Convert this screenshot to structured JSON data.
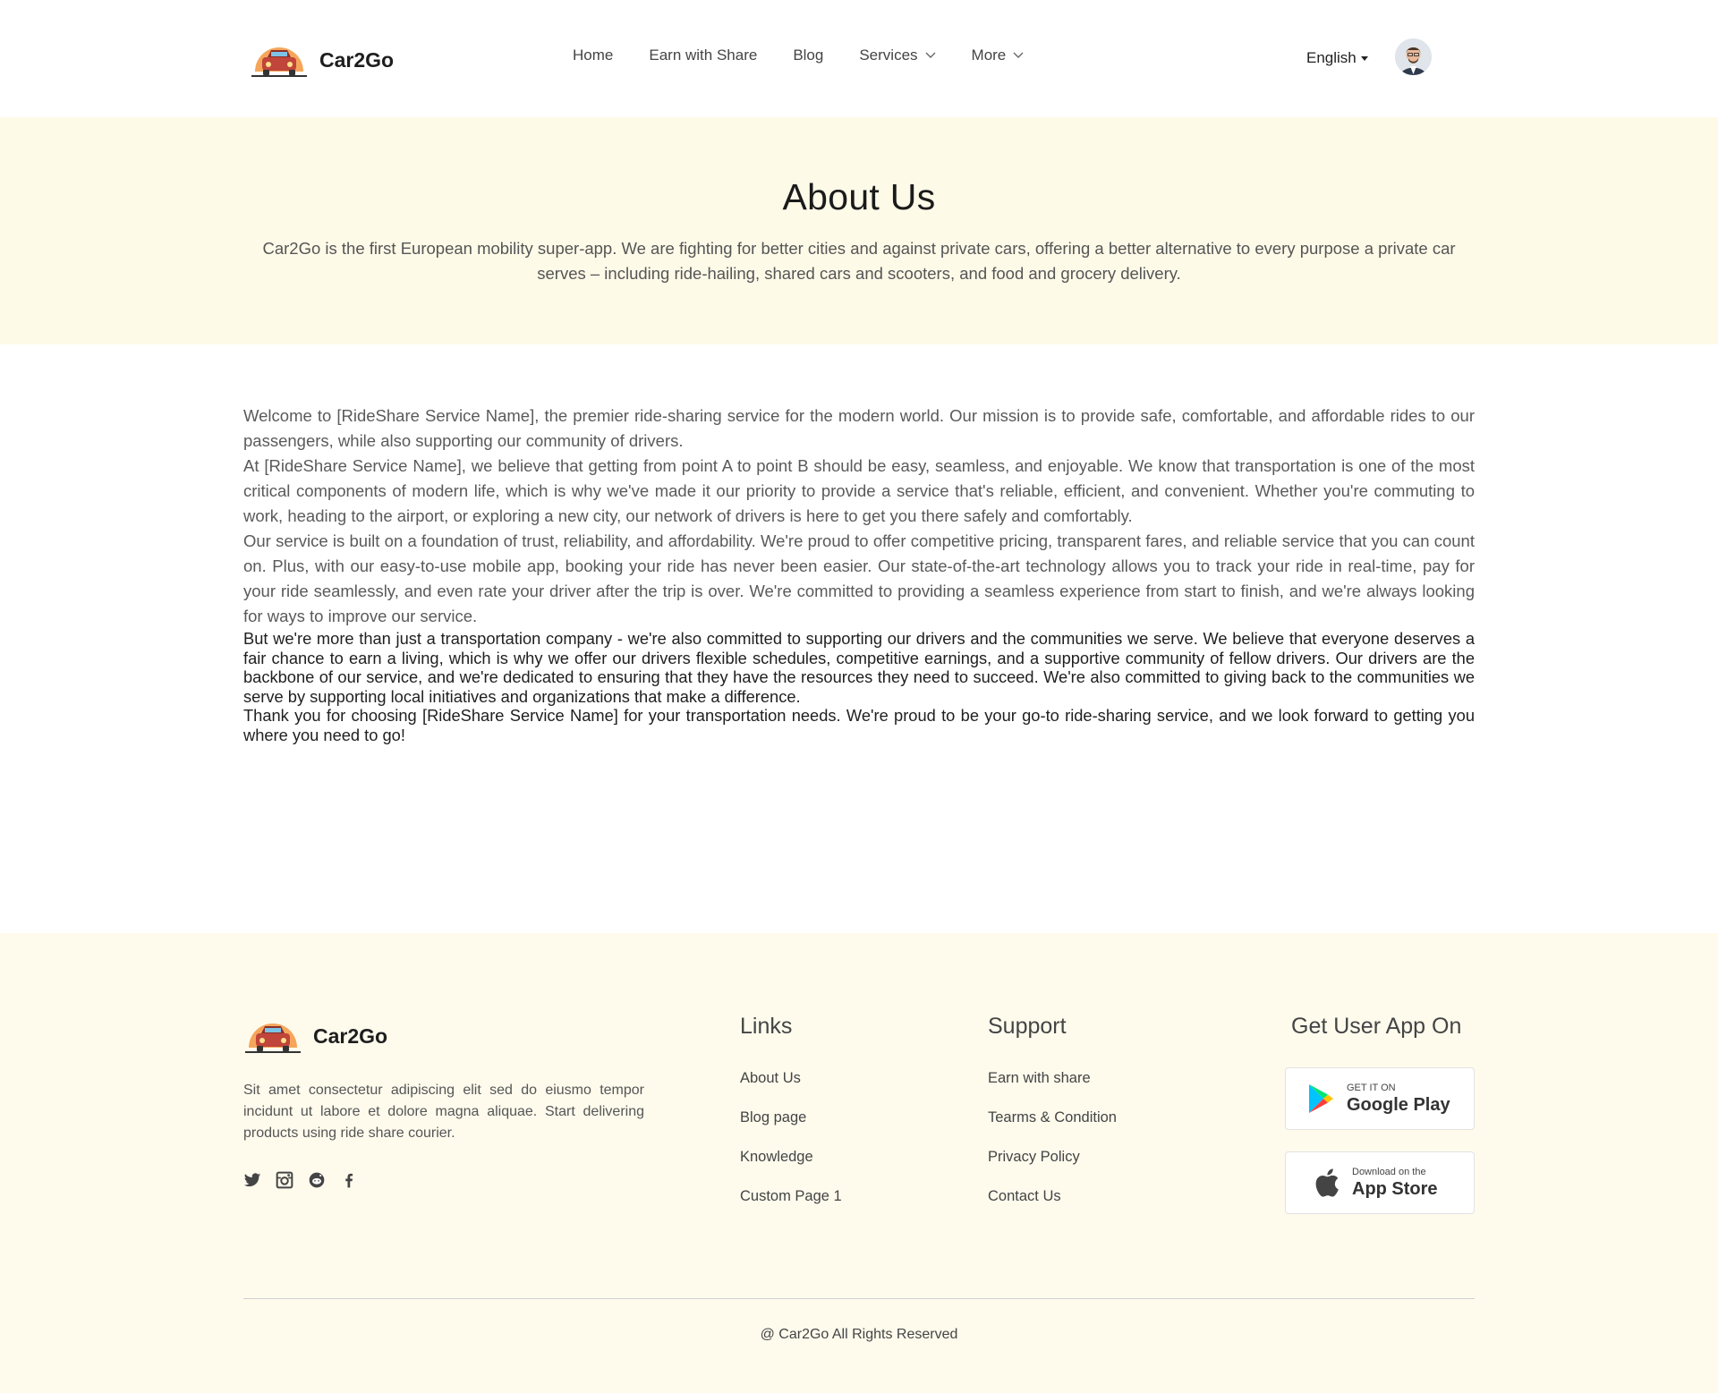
{
  "header": {
    "brand": "Car2Go",
    "nav": [
      {
        "label": "Home"
      },
      {
        "label": "Earn with Share"
      },
      {
        "label": "Blog"
      },
      {
        "label": "Services"
      },
      {
        "label": "More"
      }
    ],
    "language": "English",
    "logo_icon": "car-icon",
    "avatar_icon": "user-avatar"
  },
  "hero": {
    "title": "About Us",
    "text": "Car2Go is the first European mobility super-app. We are fighting for better cities and against private cars, offering a better alternative to every purpose a private car serves – including ride-hailing, shared cars and scooters, and food and grocery delivery."
  },
  "content": {
    "p1": "Welcome to [RideShare Service Name], the premier ride-sharing service for the modern world. Our mission is to provide safe, comfortable, and affordable rides to our passengers, while also supporting our community of drivers.",
    "p2": "At [RideShare Service Name], we believe that getting from point A to point B should be easy, seamless, and enjoyable. We know that transportation is one of the most critical components of modern life, which is why we've made it our priority to provide a service that's reliable, efficient, and convenient. Whether you're commuting to work, heading to the airport, or exploring a new city, our network of drivers is here to get you there safely and comfortably.",
    "p3": "Our service is built on a foundation of trust, reliability, and affordability. We're proud to offer competitive pricing, transparent fares, and reliable service that you can count on. Plus, with our easy-to-use mobile app, booking your ride has never been easier. Our state-of-the-art technology allows you to track your ride in real-time, pay for your ride seamlessly, and even rate your driver after the trip is over. We're committed to providing a seamless experience from start to finish, and we're always looking for ways to improve our service.",
    "p4": "But we're more than just a transportation company - we're also committed to supporting our drivers and the communities we serve. We believe that everyone deserves a fair chance to earn a living, which is why we offer our drivers flexible schedules, competitive earnings, and a supportive community of fellow drivers. Our drivers are the backbone of our service, and we're dedicated to ensuring that they have the resources they need to succeed. We're also committed to giving back to the communities we serve by supporting local initiatives and organizations that make a difference.",
    "p5": "Thank you for choosing [RideShare Service Name] for your transportation needs. We're proud to be your go-to ride-sharing service, and we look forward to getting you where you need to go!"
  },
  "footer": {
    "brand": "Car2Go",
    "description": "Sit amet consectetur adipiscing elit sed do eiusmo tempor incidunt ut labore et dolore magna aliquae. Start delivering products using ride share courier.",
    "socials": [
      "twitter-icon",
      "instagram-icon",
      "reddit-icon",
      "facebook-icon"
    ],
    "links_title": "Links",
    "links": [
      "About Us",
      "Blog page",
      "Knowledge",
      "Custom Page 1"
    ],
    "support_title": "Support",
    "support": [
      "Earn with share",
      "Tearms & Condition",
      "Privacy Policy",
      "Contact Us"
    ],
    "app_title": "Get User App On",
    "google_play": {
      "small": "GET IT ON",
      "big": "Google Play"
    },
    "app_store": {
      "small": "Download on the",
      "big": "App Store"
    },
    "copyright": "@ Car2Go All Rights Reserved"
  },
  "colors": {
    "hero_bg": "#fefae8",
    "footer_bg": "#fefbed",
    "logo_orange": "#f5a65b",
    "car_red": "#c0453a"
  }
}
